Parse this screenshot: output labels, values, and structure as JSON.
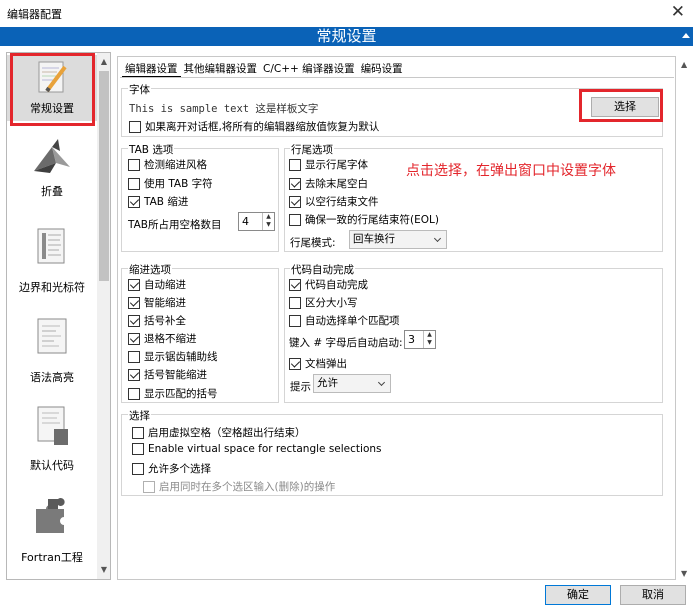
{
  "window": {
    "title": "编辑器配置",
    "close": "✕"
  },
  "header": {
    "title": "常规设置"
  },
  "sidebar": {
    "items": [
      {
        "label": "常规设置",
        "icon": "settings-pencil-icon",
        "selected": true
      },
      {
        "label": "折叠",
        "icon": "origami-icon"
      },
      {
        "label": "边界和光标符",
        "icon": "document-margin-icon"
      },
      {
        "label": "语法高亮",
        "icon": "syntax-document-icon"
      },
      {
        "label": "默认代码",
        "icon": "code-document-icon"
      },
      {
        "label": "Fortran工程",
        "icon": "puzzle-icon"
      }
    ]
  },
  "tabs": [
    "编辑器设置",
    "其他编辑器设置",
    "C/C++ 编译器设置",
    "编码设置"
  ],
  "font": {
    "title": "字体",
    "sample": "This is sample text 这是样板文字",
    "choose_button": "选择",
    "reset_label": "如果离开对话框,将所有的编辑器缩放值恢复为默认",
    "reset_checked": false
  },
  "tab_options": {
    "title": "TAB 选项",
    "items": [
      {
        "label": "检测缩进风格",
        "checked": false
      },
      {
        "label": "使用 TAB 字符",
        "checked": false
      },
      {
        "label": "TAB 缩进",
        "checked": true
      }
    ],
    "spaces_label": "TAB所占用空格数目",
    "spaces_value": "4"
  },
  "eol_options": {
    "title": "行尾选项",
    "items": [
      {
        "label": "显示行尾字体",
        "checked": false
      },
      {
        "label": "去除末尾空白",
        "checked": true
      },
      {
        "label": "以空行结束文件",
        "checked": true
      },
      {
        "label": "确保一致的行尾结束符(EOL)",
        "checked": false
      }
    ],
    "mode_label": "行尾模式:",
    "mode_value": "回车换行"
  },
  "annotation": "点击选择，在弹出窗口中设置字体",
  "indent_options": {
    "title": "缩进选项",
    "items": [
      {
        "label": "自动缩进",
        "checked": true
      },
      {
        "label": "智能缩进",
        "checked": true
      },
      {
        "label": "括号补全",
        "checked": true
      },
      {
        "label": "退格不缩进",
        "checked": true
      },
      {
        "label": "显示锯齿辅助线",
        "checked": false
      },
      {
        "label": "括号智能缩进",
        "checked": true
      },
      {
        "label": "显示匹配的括号",
        "checked": false
      }
    ]
  },
  "autocomplete": {
    "title": "代码自动完成",
    "items": [
      {
        "label": "代码自动完成",
        "checked": true
      },
      {
        "label": "区分大小写",
        "checked": false
      },
      {
        "label": "自动选择单个匹配项",
        "checked": false
      }
    ],
    "trigger_label": "键入 # 字母后自动启动:",
    "trigger_value": "3",
    "doc_popup_label": "文档弹出",
    "doc_popup_checked": true,
    "hint_label": "提示",
    "hint_value": "允许"
  },
  "selection": {
    "title": "选择",
    "items": [
      {
        "label": "启用虚拟空格（空格超出行结束）",
        "checked": false,
        "disabled": false
      },
      {
        "label": "Enable virtual space for rectangle selections",
        "checked": false,
        "disabled": false
      },
      {
        "label": "允许多个选择",
        "checked": false,
        "disabled": false
      },
      {
        "label": "启用同时在多个选区输入(删除)的操作",
        "checked": false,
        "disabled": true
      }
    ]
  },
  "footer": {
    "ok": "确定",
    "cancel": "取消"
  }
}
